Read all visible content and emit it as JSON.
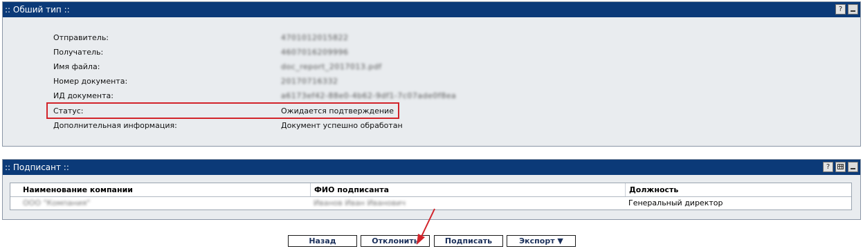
{
  "general": {
    "title": ":: Обший тип ::",
    "help": "?",
    "fields": [
      {
        "label": "Отправитель:",
        "value": "4701012015822"
      },
      {
        "label": "Получатель:",
        "value": "4607016209996"
      },
      {
        "label": "Имя файла:",
        "value": "doc_report_2017013.pdf"
      },
      {
        "label": "Номер документа:",
        "value": "20170716332"
      },
      {
        "label": "ИД документа:",
        "value": "a6173ef42-88e0-4b62-9df1-7c07ade0f8ea"
      },
      {
        "label": "Статус:",
        "value": "Ожидается подтверждение"
      },
      {
        "label": "Дополнительная информация:",
        "value": "Документ успешно обработан"
      }
    ]
  },
  "signer": {
    "title": ":: Подписант ::",
    "help": "?",
    "columns": [
      "Наименование компании",
      "ФИО подписанта",
      "Должность"
    ],
    "rows": [
      [
        "ООО \"Компания\"",
        "Иванов Иван Иванович",
        "Генеральный директор"
      ]
    ]
  },
  "buttons": {
    "back": "Назад",
    "reject": "Отклонить",
    "sign": "Подписать",
    "export": "Экспорт ▼"
  },
  "colors": {
    "header": "#0b3a78",
    "panel": "#e9ecef",
    "highlight": "#d2232a"
  }
}
